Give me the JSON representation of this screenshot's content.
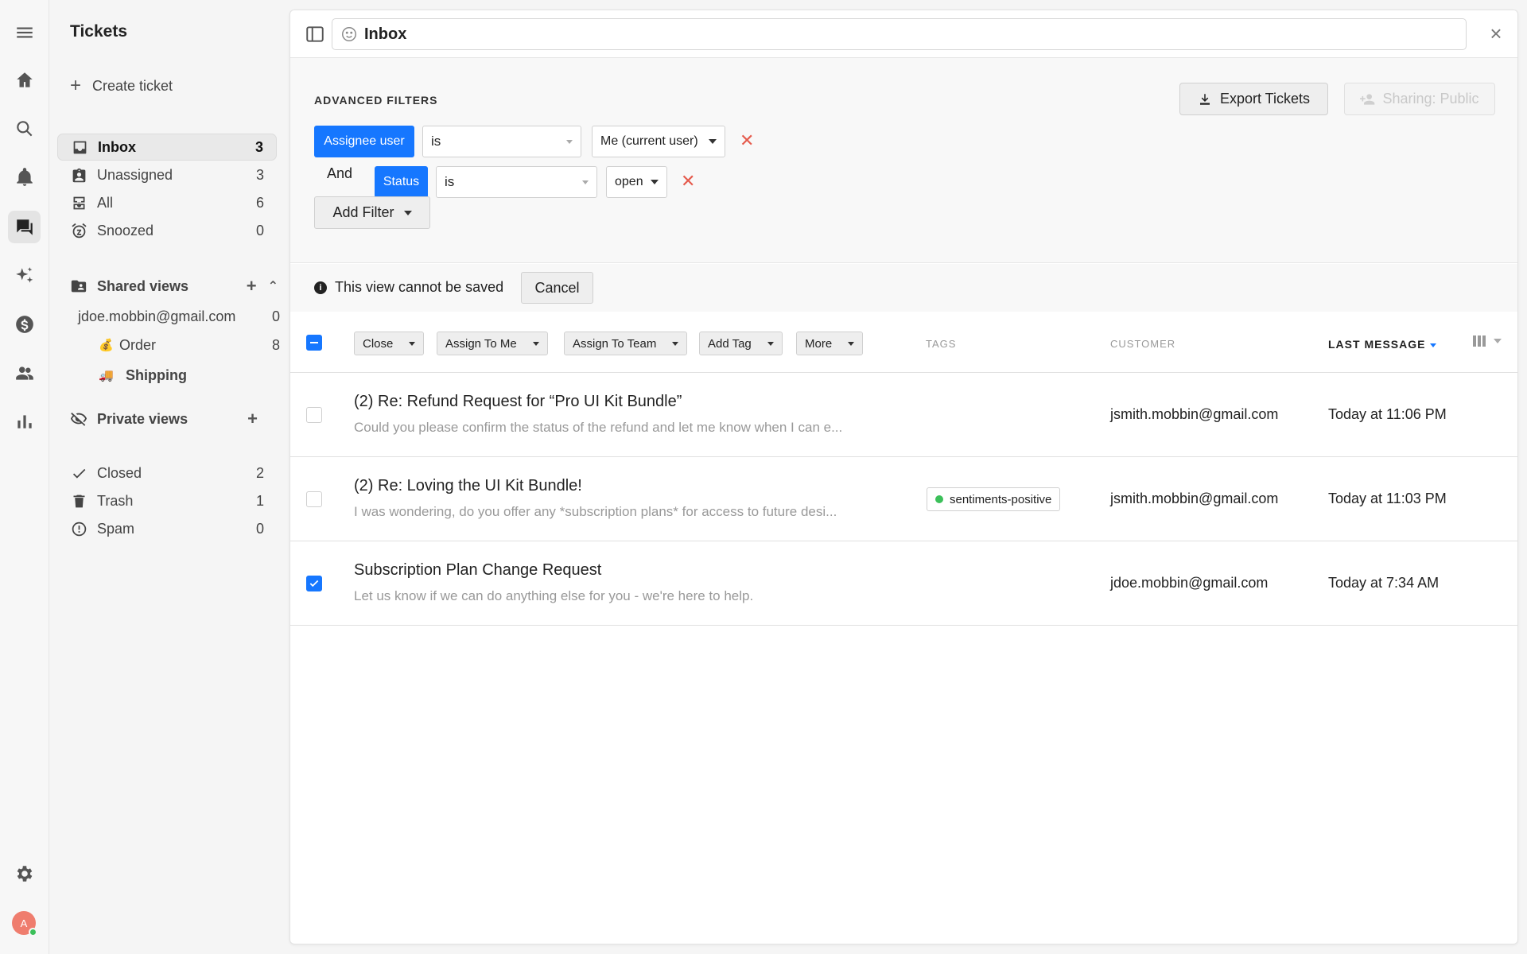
{
  "sidebar": {
    "title": "Tickets",
    "create_label": "Create ticket",
    "views": [
      {
        "label": "Inbox",
        "count": "3",
        "icon": "inbox-icon"
      },
      {
        "label": "Unassigned",
        "count": "3",
        "icon": "unassigned-icon"
      },
      {
        "label": "All",
        "count": "6",
        "icon": "all-icon"
      },
      {
        "label": "Snoozed",
        "count": "0",
        "icon": "snooze-icon"
      }
    ],
    "shared_views_label": "Shared views",
    "shared_views": [
      {
        "label": "jdoe.mobbin@gmail.com",
        "count": "0",
        "emoji": ""
      },
      {
        "label": "Order",
        "count": "8",
        "emoji": "💰"
      },
      {
        "label": "Shipping",
        "count": "",
        "emoji": "🚚"
      }
    ],
    "private_views_label": "Private views",
    "status_views": [
      {
        "label": "Closed",
        "count": "2",
        "icon": "check-icon"
      },
      {
        "label": "Trash",
        "count": "1",
        "icon": "trash-icon"
      },
      {
        "label": "Spam",
        "count": "0",
        "icon": "spam-icon"
      }
    ]
  },
  "header": {
    "title": "Inbox"
  },
  "filters": {
    "label": "ADVANCED FILTERS",
    "export_label": "Export Tickets",
    "sharing_label": "Sharing: Public",
    "rows": [
      {
        "conjunction": "",
        "field": "Assignee user",
        "operator": "is",
        "value": "Me (current user)"
      },
      {
        "conjunction": "And",
        "field": "Status",
        "operator": "is",
        "value": "open"
      }
    ],
    "add_filter_label": "Add Filter"
  },
  "save_bar": {
    "message": "This view cannot be saved",
    "cancel_label": "Cancel"
  },
  "table": {
    "bulk_actions": [
      "Close",
      "Assign To Me",
      "Assign To Team",
      "Add Tag",
      "More"
    ],
    "columns": {
      "tags": "TAGS",
      "customer": "CUSTOMER",
      "last_message": "LAST MESSAGE"
    },
    "rows": [
      {
        "subject": "(2) Re: Refund Request for “Pro UI Kit Bundle”",
        "preview": "Could you please confirm the status of the refund and let me know when I can e...",
        "tag": "",
        "customer": "jsmith.mobbin@gmail.com",
        "last_message": "Today at 11:06 PM",
        "checked": false
      },
      {
        "subject": "(2) Re: Loving the UI Kit Bundle!",
        "preview": "I was wondering, do you offer any *subscription plans* for access to future desi...",
        "tag": "sentiments-positive",
        "customer": "jsmith.mobbin@gmail.com",
        "last_message": "Today at 11:03 PM",
        "checked": false
      },
      {
        "subject": "Subscription Plan Change Request",
        "preview": "Let us know if we can do anything else for you - we're here to help.",
        "tag": "",
        "customer": "jdoe.mobbin@gmail.com",
        "last_message": "Today at 7:34 AM",
        "checked": true
      }
    ]
  },
  "user": {
    "avatar_initial": "A"
  },
  "colors": {
    "accent": "#1677ff",
    "danger": "#e55b4d",
    "positive": "#3cc05a"
  }
}
